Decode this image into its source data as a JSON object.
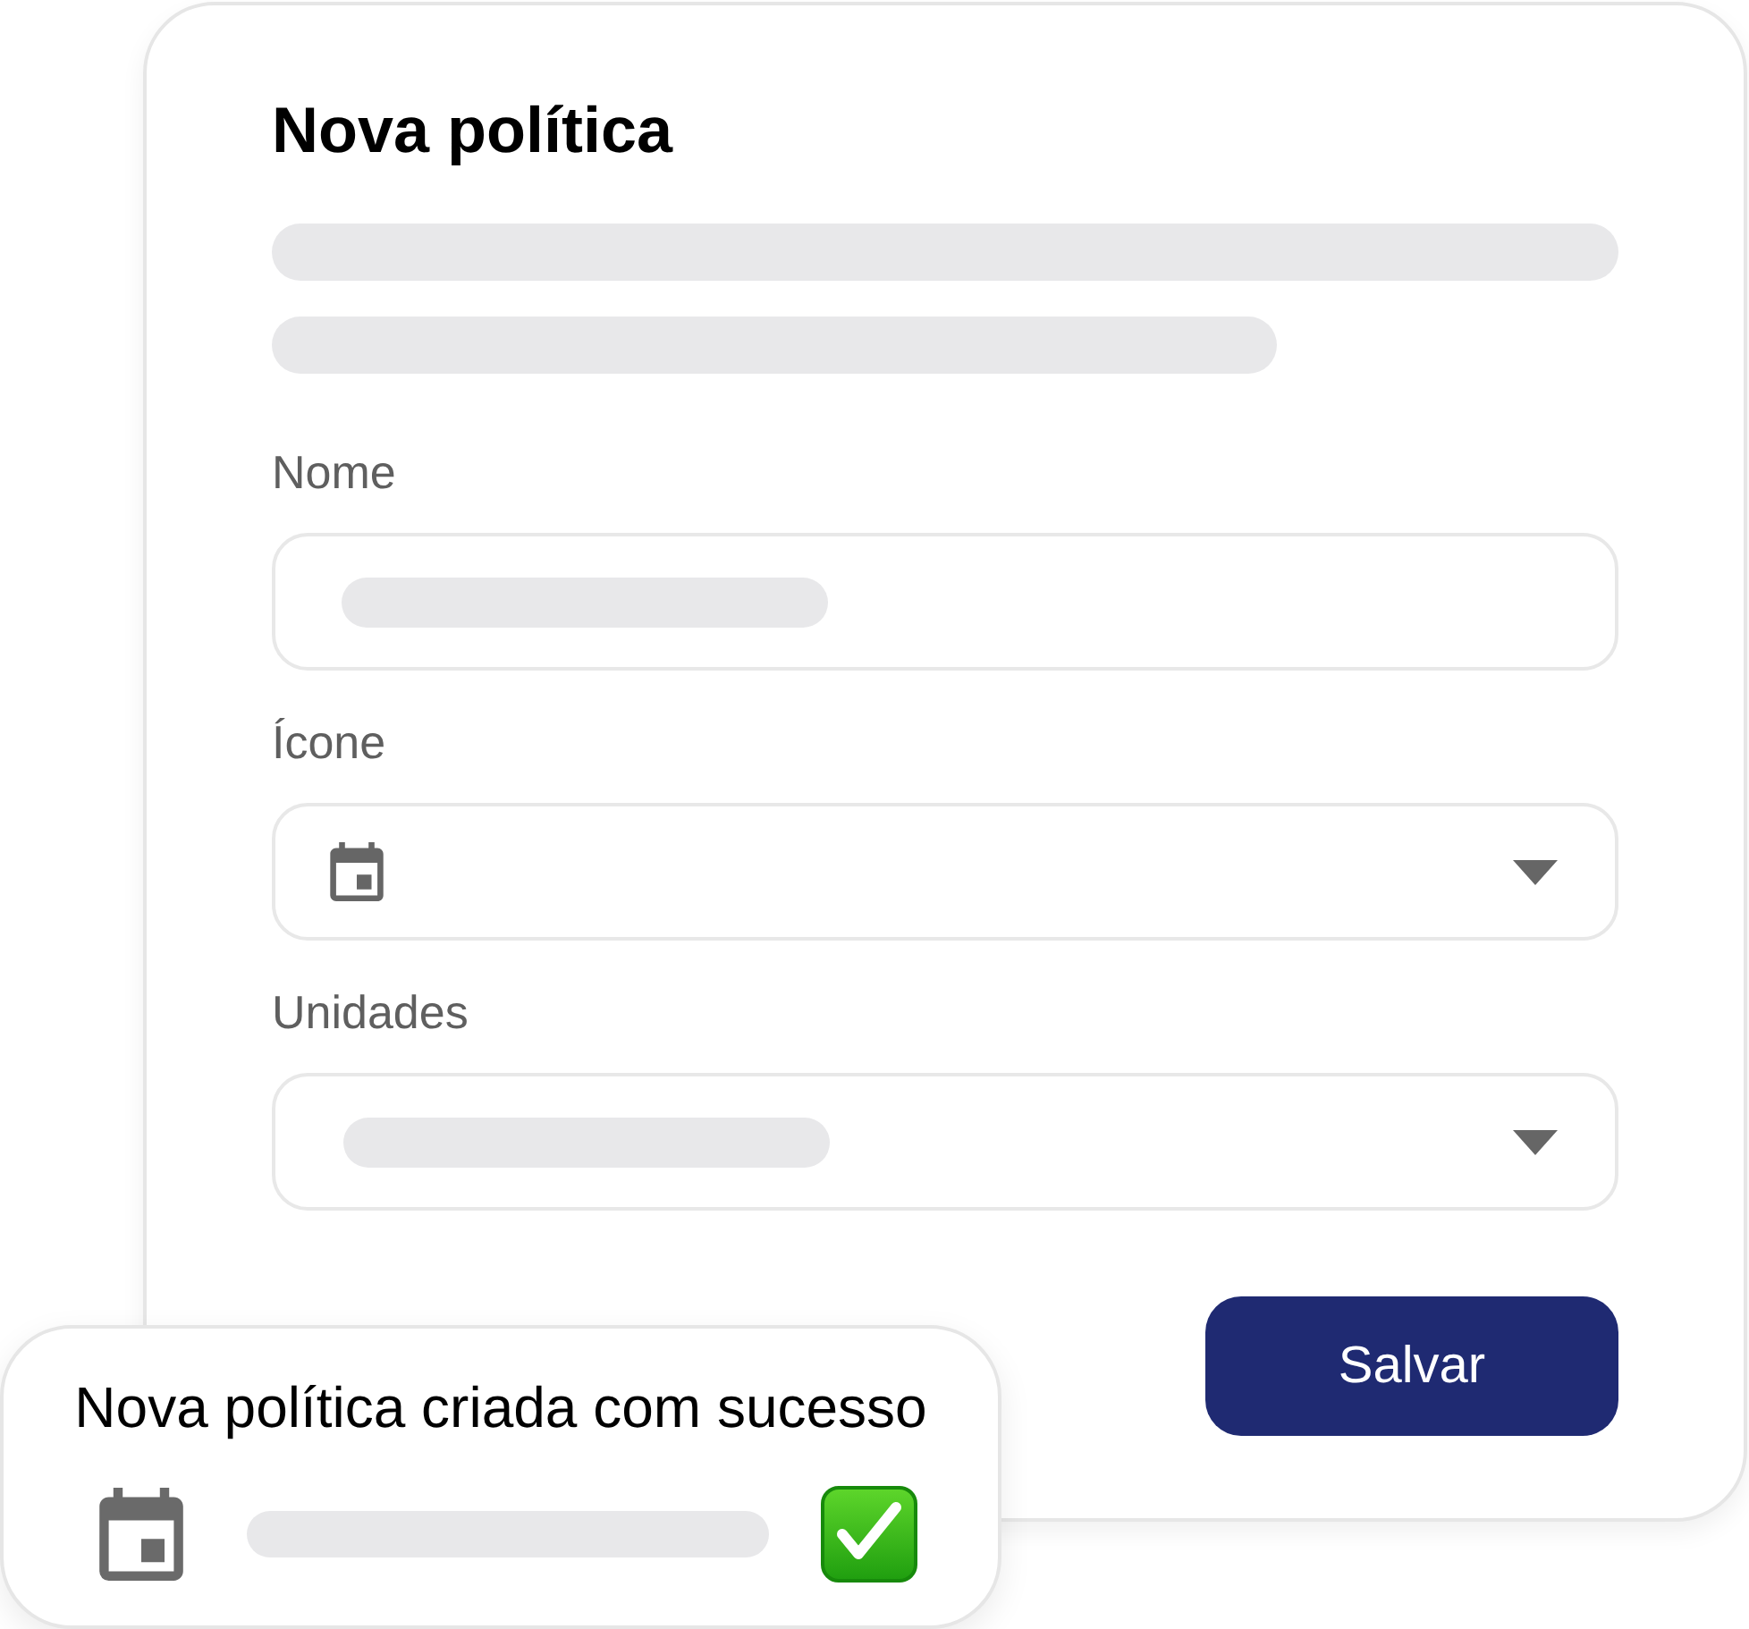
{
  "form": {
    "title": "Nova política",
    "fields": [
      {
        "label": "Nome",
        "kind": "input"
      },
      {
        "label": "Ícone",
        "kind": "iconpicker"
      },
      {
        "label": "Unidades",
        "kind": "select"
      }
    ],
    "submit_button": "Salvar"
  },
  "toast": {
    "message": "Nova política criada com sucesso"
  }
}
